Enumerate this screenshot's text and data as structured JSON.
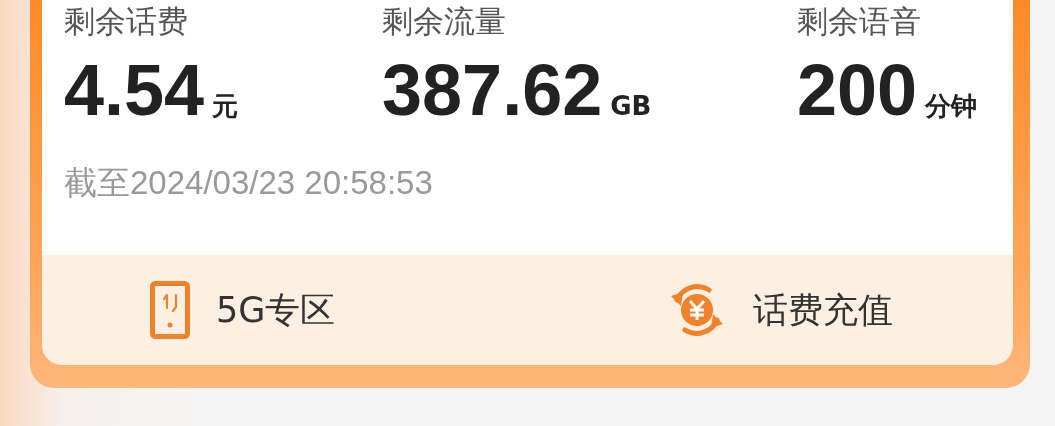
{
  "balances": [
    {
      "label": "剩余话费",
      "value": "4.54",
      "unit": "元"
    },
    {
      "label": "剩余流量",
      "value": "387.62",
      "unit": "GB"
    },
    {
      "label": "剩余语音",
      "value": "200",
      "unit": "分钟"
    }
  ],
  "updated": "截至2024/03/23 20:58:53",
  "shortcuts": [
    {
      "kind": "phone",
      "label": "5G专区"
    },
    {
      "kind": "recharge",
      "label": "话费充值"
    }
  ]
}
